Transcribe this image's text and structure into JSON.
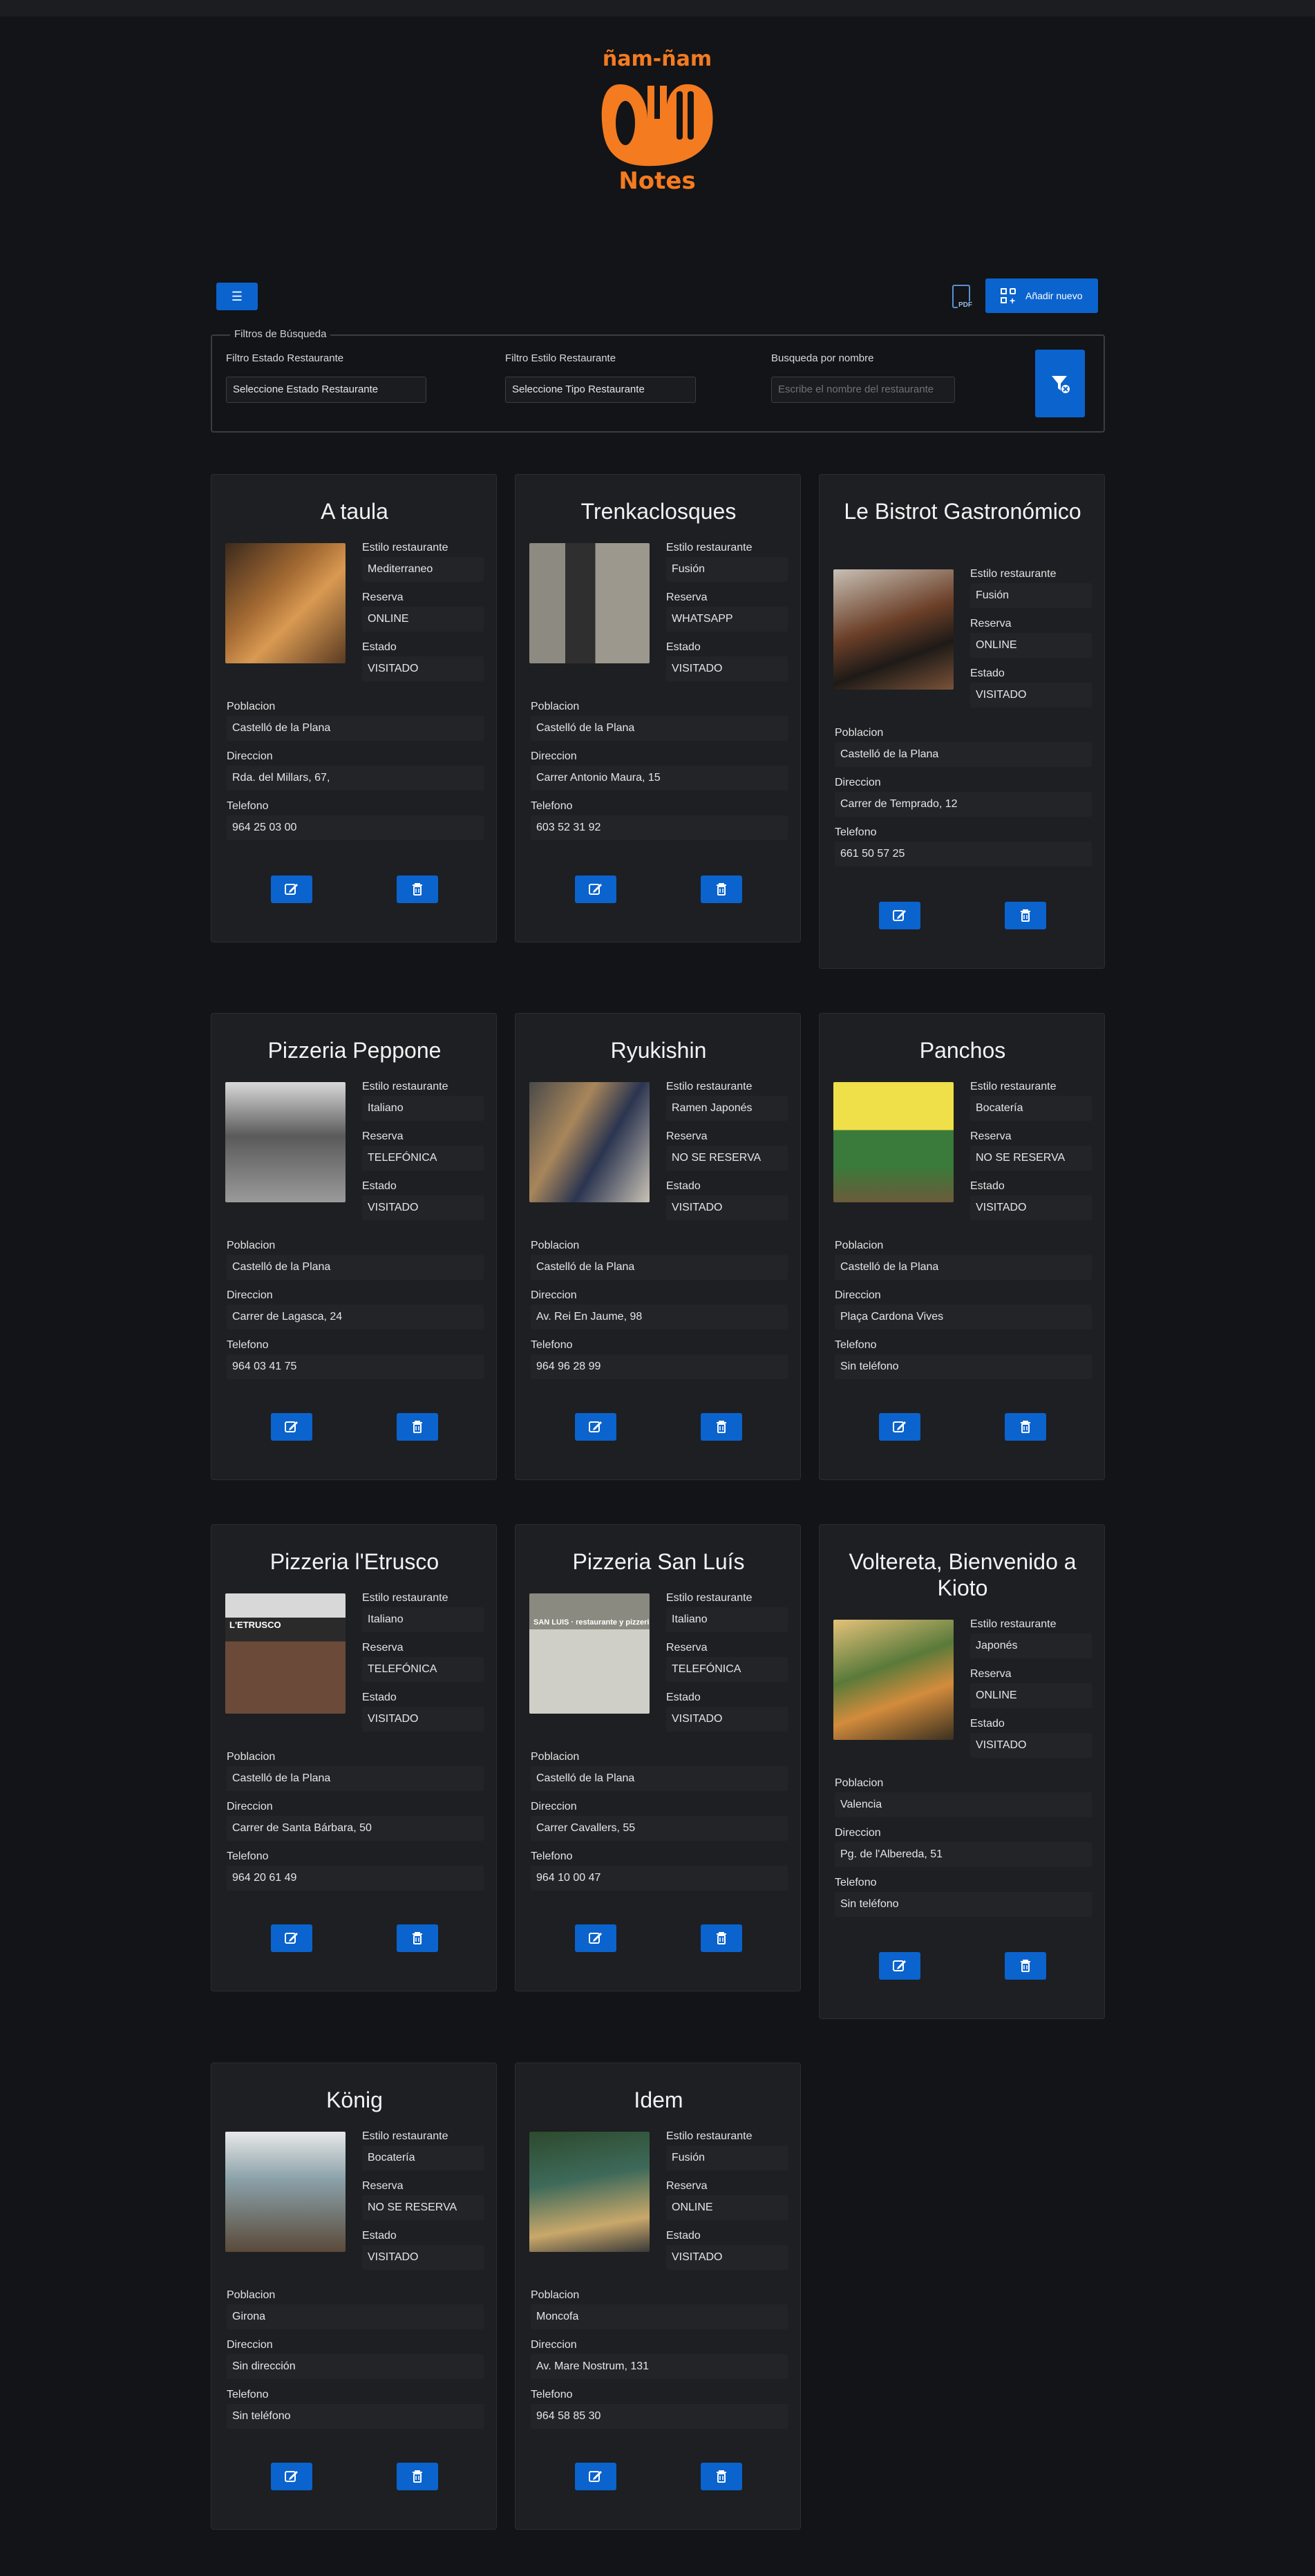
{
  "brand": {
    "top_text": "ñam-ñam",
    "bottom_text": "Notes"
  },
  "toolbar": {
    "menu_icon": "hamburger-icon",
    "pdf_label": "PDF",
    "add_label": "Añadir nuevo"
  },
  "filters": {
    "legend": "Filtros de Búsqueda",
    "estado_label": "Filtro Estado Restaurante",
    "estado_value": "Seleccione Estado Restaurante",
    "estilo_label": "Filtro Estilo Restaurante",
    "estilo_value": "Seleccione Tipo Restaurante",
    "search_label": "Busqueda por nombre",
    "search_placeholder": "Escribe el nombre del restaurante"
  },
  "field_labels": {
    "estilo": "Estilo restaurante",
    "reserva": "Reserva",
    "estado": "Estado",
    "poblacion": "Poblacion",
    "direccion": "Direccion",
    "telefono": "Telefono"
  },
  "restaurants": [
    {
      "name": "A taula",
      "estilo": "Mediterraneo",
      "reserva": "ONLINE",
      "estado": "VISITADO",
      "poblacion": "Castelló de la Plana",
      "direccion": "Rda. del Millars, 67,",
      "telefono": "964 25 03 00"
    },
    {
      "name": "Trenkaclosques",
      "estilo": "Fusión",
      "reserva": "WHATSAPP",
      "estado": "VISITADO",
      "poblacion": "Castelló de la Plana",
      "direccion": "Carrer Antonio Maura, 15",
      "telefono": "603 52 31 92"
    },
    {
      "name": "Le Bistrot Gastronómico",
      "estilo": "Fusión",
      "reserva": "ONLINE",
      "estado": "VISITADO",
      "poblacion": "Castelló de la Plana",
      "direccion": "Carrer de Temprado, 12",
      "telefono": "661 50 57 25"
    },
    {
      "name": "Pizzeria Peppone",
      "estilo": "Italiano",
      "reserva": "TELEFÓNICA",
      "estado": "VISITADO",
      "poblacion": "Castelló de la Plana",
      "direccion": "Carrer de Lagasca, 24",
      "telefono": "964 03 41 75"
    },
    {
      "name": "Ryukishin",
      "estilo": "Ramen Japonés",
      "reserva": "NO SE RESERVA",
      "estado": "VISITADO",
      "poblacion": "Castelló de la Plana",
      "direccion": "Av. Rei En Jaume, 98",
      "telefono": "964 96 28 99"
    },
    {
      "name": "Panchos",
      "estilo": "Bocatería",
      "reserva": "NO SE RESERVA",
      "estado": "VISITADO",
      "poblacion": "Castelló de la Plana",
      "direccion": "Plaça Cardona Vives",
      "telefono": "Sin teléfono"
    },
    {
      "name": "Pizzeria l'Etrusco",
      "estilo": "Italiano",
      "reserva": "TELEFÓNICA",
      "estado": "VISITADO",
      "poblacion": "Castelló de la Plana",
      "direccion": "Carrer de Santa Bárbara, 50",
      "telefono": "964 20 61 49",
      "sign": "L'ETRUSCO"
    },
    {
      "name": "Pizzeria San Luís",
      "estilo": "Italiano",
      "reserva": "TELEFÓNICA",
      "estado": "VISITADO",
      "poblacion": "Castelló de la Plana",
      "direccion": "Carrer Cavallers, 55",
      "telefono": "964 10 00 47",
      "sign": "SAN LUIS · restaurante y pizzeria"
    },
    {
      "name": "Voltereta, Bienvenido a Kioto",
      "estilo": "Japonés",
      "reserva": "ONLINE",
      "estado": "VISITADO",
      "poblacion": "Valencia",
      "direccion": "Pg. de l'Albereda, 51",
      "telefono": "Sin teléfono"
    },
    {
      "name": "König",
      "estilo": "Bocatería",
      "reserva": "NO SE RESERVA",
      "estado": "VISITADO",
      "poblacion": "Girona",
      "direccion": "Sin dirección",
      "telefono": "Sin teléfono"
    },
    {
      "name": "Idem",
      "estilo": "Fusión",
      "reserva": "ONLINE",
      "estado": "VISITADO",
      "poblacion": "Moncofa",
      "direccion": "Av. Mare Nostrum, 131",
      "telefono": "964 58 85 30"
    }
  ],
  "colors": {
    "accent": "#0b63ce",
    "brand": "#f47b20",
    "background": "#121417",
    "card": "#1d1f22"
  }
}
